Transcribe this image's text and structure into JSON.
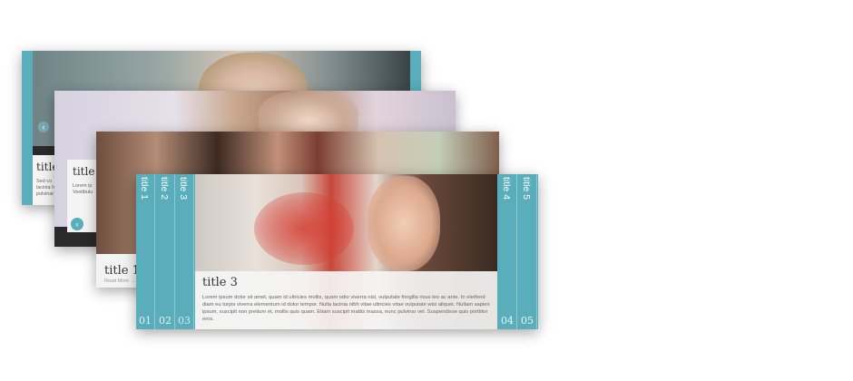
{
  "slider": {
    "front": {
      "tabs_left": [
        {
          "title": "title 1",
          "number": "01"
        },
        {
          "title": "title 2",
          "number": "02"
        },
        {
          "title": "title 3",
          "number": "03"
        }
      ],
      "tabs_right": [
        {
          "title": "title 4",
          "number": "04"
        },
        {
          "title": "title 5",
          "number": "05"
        }
      ],
      "caption_title": "title 3",
      "caption_text": "Lorem ipsum dolor sit amet, quam id ultricies mollis, quam odio viverra nisl, vulputate fringilla risus leo ac ante. In eleifend diam eu turpis viverra elementum id dolor tempor. Nulla lacinia nibh vitae ultricies vitae vulputate wisi aliquet. Nullam sapien ipsum, suscipit non pretium et, mollis quis quam. Etiam suscipit mattis massa, nunc pulvinar vel. Suspendisse quis porttitor eros."
    },
    "back1": {
      "title": "title",
      "text": "Sed co lacinia h pulvinar"
    },
    "back2": {
      "title": "title",
      "text": "Lorem ip Vestibulu"
    },
    "back3": {
      "title": "title 1",
      "read_more": "Read More →"
    },
    "accent_color": "#5aaebc",
    "arrow_icon": "chevron-left-icon"
  }
}
